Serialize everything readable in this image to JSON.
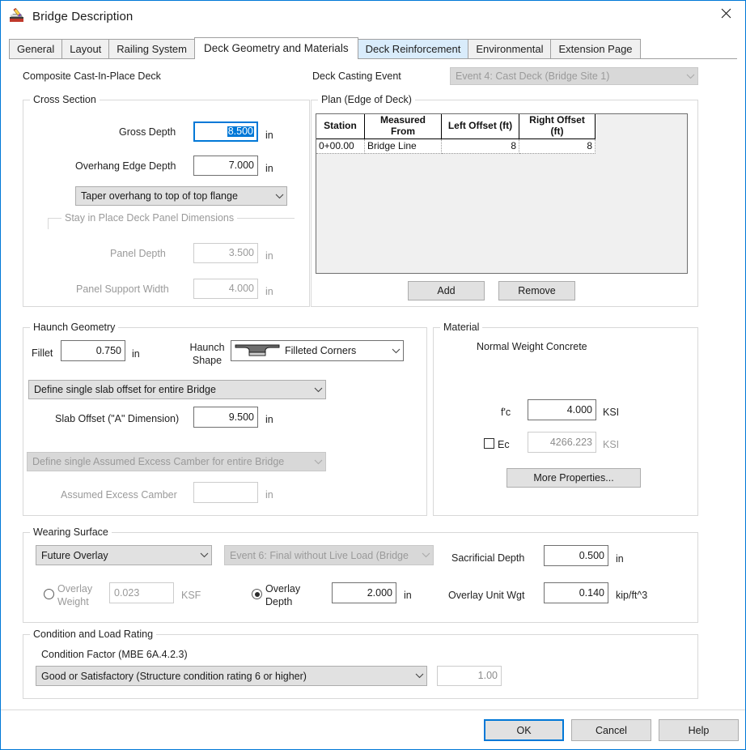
{
  "window": {
    "title": "Bridge Description",
    "icon": "bridge-description-icon",
    "close_icon": "close-icon",
    "accent_color": "#0078d7"
  },
  "tabs": [
    {
      "label": "General",
      "state": "normal"
    },
    {
      "label": "Layout",
      "state": "normal"
    },
    {
      "label": "Railing System",
      "state": "normal"
    },
    {
      "label": "Deck Geometry and Materials",
      "state": "selected"
    },
    {
      "label": "Deck Reinforcement",
      "state": "hover"
    },
    {
      "label": "Environmental",
      "state": "normal"
    },
    {
      "label": "Extension Page",
      "state": "normal"
    }
  ],
  "header": {
    "deck_type_label": "Composite Cast-In-Place Deck",
    "casting_event_label": "Deck Casting Event",
    "casting_event_value": "Event 4: Cast Deck (Bridge Site 1)"
  },
  "cross_section": {
    "title": "Cross Section",
    "gross_depth_label": "Gross Depth",
    "gross_depth_value": "8.500",
    "gross_depth_unit": "in",
    "overhang_edge_depth_label": "Overhang Edge Depth",
    "overhang_edge_depth_value": "7.000",
    "overhang_edge_depth_unit": "in",
    "taper_option": "Taper overhang to top of top flange",
    "sip_title": "Stay in Place Deck Panel Dimensions",
    "panel_depth_label": "Panel Depth",
    "panel_depth_value": "3.500",
    "panel_depth_unit": "in",
    "panel_support_width_label": "Panel Support Width",
    "panel_support_width_value": "4.000",
    "panel_support_width_unit": "in"
  },
  "plan": {
    "title": "Plan (Edge of Deck)",
    "columns": [
      "Station",
      "Measured From",
      "Left Offset (ft)",
      "Right Offset (ft)"
    ],
    "rows": [
      {
        "station": "0+00.00",
        "measured_from": "Bridge Line",
        "left_offset": "8",
        "right_offset": "8"
      }
    ],
    "add_label": "Add",
    "remove_label": "Remove"
  },
  "haunch": {
    "title": "Haunch Geometry",
    "fillet_label": "Fillet",
    "fillet_value": "0.750",
    "fillet_unit": "in",
    "haunch_shape_label_line1": "Haunch",
    "haunch_shape_label_line2": "Shape",
    "haunch_shape_value": "Filleted Corners",
    "slab_offset_mode": "Define single slab offset for entire Bridge",
    "slab_offset_label": "Slab Offset (\"A\" Dimension)",
    "slab_offset_value": "9.500",
    "slab_offset_unit": "in",
    "camber_mode": "Define single Assumed Excess Camber for entire Bridge",
    "camber_label": "Assumed Excess Camber",
    "camber_value": "",
    "camber_unit": "in"
  },
  "material": {
    "title": "Material",
    "concrete_label": "Normal Weight Concrete",
    "fc_label": "f'c",
    "fc_value": "4.000",
    "fc_unit": "KSI",
    "ec_label": "Ec",
    "ec_checked": false,
    "ec_value": "4266.223",
    "ec_unit": "KSI",
    "more_properties_label": "More Properties..."
  },
  "wearing_surface": {
    "title": "Wearing Surface",
    "type_value": "Future Overlay",
    "event_value": "Event 6: Final without Live Load (Bridge",
    "overlay_weight_label_line1": "Overlay",
    "overlay_weight_label_line2": "Weight",
    "overlay_weight_selected": false,
    "overlay_weight_value": "0.023",
    "overlay_weight_unit": "KSF",
    "overlay_depth_label_line1": "Overlay",
    "overlay_depth_label_line2": "Depth",
    "overlay_depth_selected": true,
    "overlay_depth_value": "2.000",
    "overlay_depth_unit": "in",
    "sacrificial_depth_label": "Sacrificial Depth",
    "sacrificial_depth_value": "0.500",
    "sacrificial_depth_unit": "in",
    "overlay_unit_wgt_label": "Overlay Unit Wgt",
    "overlay_unit_wgt_value": "0.140",
    "overlay_unit_wgt_unit": "kip/ft^3"
  },
  "condition": {
    "title": "Condition and Load Rating",
    "factor_label": "Condition Factor (MBE 6A.4.2.3)",
    "factor_value": "Good or Satisfactory (Structure condition rating 6 or higher)",
    "factor_number": "1.00"
  },
  "footer": {
    "ok_label": "OK",
    "cancel_label": "Cancel",
    "help_label": "Help"
  }
}
